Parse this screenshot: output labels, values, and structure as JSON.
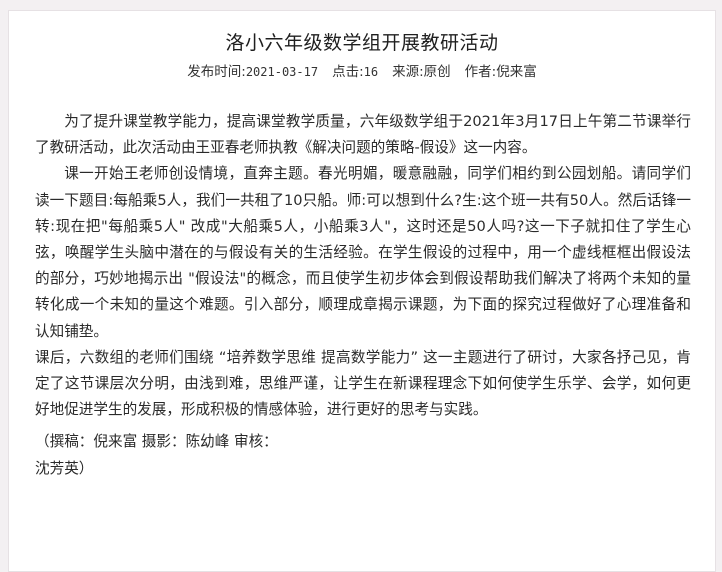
{
  "article": {
    "title": "洛小六年级数学组开展教研活动",
    "meta": {
      "published_label": "发布时间:",
      "published_value": "2021-03-17",
      "clicks_label": "点击:",
      "clicks_value": "16",
      "source_label": "来源:",
      "source_value": "原创",
      "author_label": "作者:",
      "author_value": "倪来富"
    },
    "paragraphs": [
      "为了提升课堂教学能力，提高课堂教学质量，六年级数学组于2021年3月17日上午第二节课举行了教研活动，此次活动由王亚春老师执教《解决问题的策略-假设》这一内容。",
      "课一开始王老师创设情境，直奔主题。春光明媚，暖意融融，同学们相约到公园划船。请同学们读一下题目:每船乘5人，我们一共租了10只船。师:可以想到什么?生:这个班一共有50人。然后话锋一转:现在把\"每船乘5人\" 改成\"大船乘5人，小船乘3人\"，这时还是50人吗?这一下子就扣住了学生心弦，唤醒学生头脑中潜在的与假设有关的生活经验。在学生假设的过程中，用一个虚线框框出假设法的部分，巧妙地揭示出 \"假设法\"的概念，而且使学生初步体会到假设帮助我们解决了将两个未知的量转化成一个未知的量这个难题。引入部分，顺理成章揭示课题，为下面的探究过程做好了心理准备和认知铺垫。",
      "课后，六数组的老师们围绕 “培养数学思维  提高数学能力” 这一主题进行了研讨，大家各抒己见，肯定了这节课层次分明，由浅到难，思维严谨，让学生在新课程理念下如何使学生乐学、会学，如何更好地促进学生的发展，形成积极的情感体验，进行更好的思考与实践。"
    ],
    "credit_line": "（撰稿：倪来富   摄影：陈幼峰   审核：",
    "credit_tail": "沈芳英）"
  }
}
